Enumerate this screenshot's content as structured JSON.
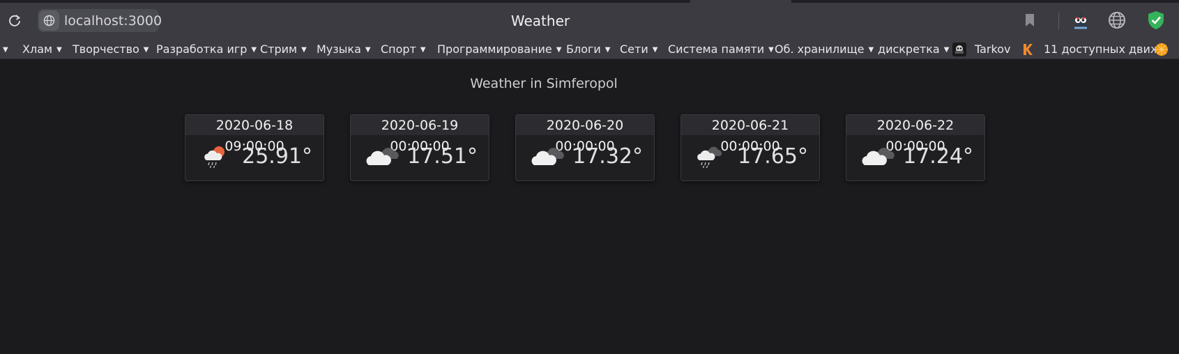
{
  "browser": {
    "url": "localhost:3000",
    "tab_title": "Weather",
    "icons": [
      "reload-icon",
      "site-info-icon",
      "bookmark-icon",
      "extension-icon",
      "globe-icon",
      "shield-icon"
    ]
  },
  "bookmarks": [
    {
      "label": "Хлам",
      "folder": true
    },
    {
      "label": "Творчество",
      "folder": true
    },
    {
      "label": "Разработка игр",
      "folder": true
    },
    {
      "label": "Стрим",
      "folder": true
    },
    {
      "label": "Музыка",
      "folder": true
    },
    {
      "label": "Спорт",
      "folder": true
    },
    {
      "label": "Программирование",
      "folder": true
    },
    {
      "label": "Блоги",
      "folder": true
    },
    {
      "label": "Сети",
      "folder": true
    },
    {
      "label": "Система памяти",
      "folder": true
    },
    {
      "label": "Об. хранилище",
      "folder": true
    },
    {
      "label": "дискретка",
      "folder": true
    },
    {
      "label": "Tarkov",
      "folder": false
    },
    {
      "label": "11 доступных движ",
      "folder": false
    }
  ],
  "arrow": "▼",
  "page": {
    "heading": "Weather in Simferopol",
    "forecasts": [
      {
        "datetime": "2020-06-18 09:00:00",
        "temp": "25.91°",
        "icon": "rain-sun-icon"
      },
      {
        "datetime": "2020-06-19 00:00:00",
        "temp": "17.51°",
        "icon": "cloudy-icon"
      },
      {
        "datetime": "2020-06-20 00:00:00",
        "temp": "17.32°",
        "icon": "cloudy-icon"
      },
      {
        "datetime": "2020-06-21 00:00:00",
        "temp": "17.65°",
        "icon": "cloud-rain-icon"
      },
      {
        "datetime": "2020-06-22 00:00:00",
        "temp": "17.24°",
        "icon": "cloudy-icon"
      }
    ]
  }
}
